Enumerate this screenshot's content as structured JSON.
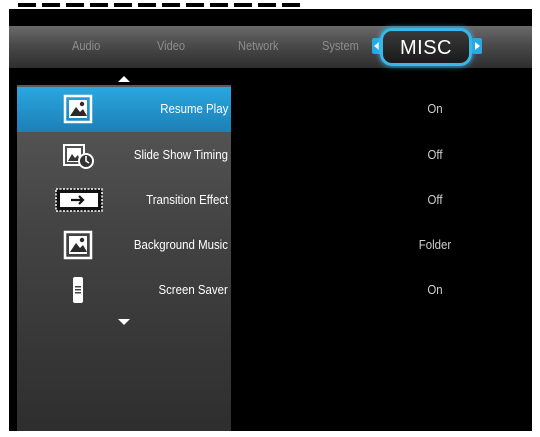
{
  "tabs": [
    {
      "label": "Audio"
    },
    {
      "label": "Video"
    },
    {
      "label": "Network"
    },
    {
      "label": "System"
    },
    {
      "label": "MISC"
    }
  ],
  "active_tab": "MISC",
  "menu": [
    {
      "label": "Resume Play",
      "value": "On",
      "icon": "photo-icon",
      "selected": true
    },
    {
      "label": "Slide Show Timing",
      "value": "Off",
      "icon": "slideshow-timer-icon"
    },
    {
      "label": "Transition Effect",
      "value": "Off",
      "icon": "transition-icon"
    },
    {
      "label": "Background Music",
      "value": "Folder",
      "icon": "music-photo-icon"
    },
    {
      "label": "Screen Saver",
      "value": "On",
      "icon": "remote-icon"
    }
  ],
  "colors": {
    "accent": "#29a8e3",
    "background": "#000000",
    "panel": "#4a4a4a"
  }
}
